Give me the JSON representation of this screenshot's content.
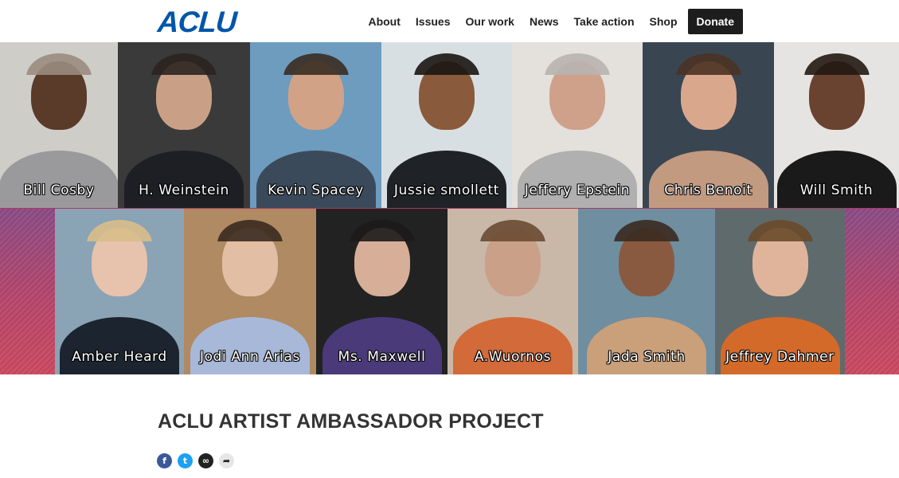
{
  "header": {
    "logo": "ACLU",
    "nav": [
      "About",
      "Issues",
      "Our work",
      "News",
      "Take action",
      "Shop"
    ],
    "donate_label": "Donate"
  },
  "collage": {
    "row1": [
      {
        "name": "Bill Cosby",
        "bg": "#cfcdc8",
        "skin": "#5a3a28",
        "cloth": "#9a9a9c",
        "hair": "#9a8c80"
      },
      {
        "name": "H. Weinstein",
        "bg": "#3a3a3a",
        "skin": "#c9a086",
        "cloth": "#1d1f24",
        "hair": "#2b2420"
      },
      {
        "name": "Kevin Spacey",
        "bg": "#6d9cbf",
        "skin": "#d1a286",
        "cloth": "#3b4a5a",
        "hair": "#3a2c22"
      },
      {
        "name": "Jussie smollett",
        "bg": "#d8dfe3",
        "skin": "#8a5a3c",
        "cloth": "#1f2226",
        "hair": "#1a1512"
      },
      {
        "name": "Jeffery Epstein",
        "bg": "#e4e0dc",
        "skin": "#cfa08a",
        "cloth": "#b0b0b0",
        "hair": "#b8b4b0"
      },
      {
        "name": "Chris Benoit",
        "bg": "#3a4552",
        "skin": "#d9a88c",
        "cloth": "#c29a80",
        "hair": "#4a3224"
      },
      {
        "name": "Will Smith",
        "bg": "#e6e4e2",
        "skin": "#6a4230",
        "cloth": "#1a1a1a",
        "hair": "#221812"
      }
    ],
    "row2": [
      {
        "name": "Amber Heard",
        "bg": "#8aa3b5",
        "skin": "#e7c2ac",
        "cloth": "#1c2430",
        "hair": "#d8be8a"
      },
      {
        "name": "Jodi Ann Arias",
        "bg": "#b08a62",
        "skin": "#e2bfa4",
        "cloth": "#a8b8d8",
        "hair": "#3a2a20"
      },
      {
        "name": "Ms. Maxwell",
        "bg": "#222222",
        "skin": "#d7ae98",
        "cloth": "#4a3a7a",
        "hair": "#1c1a1a"
      },
      {
        "name": "A.Wuornos",
        "bg": "#c9b8a8",
        "skin": "#caa088",
        "cloth": "#d26a3a",
        "hair": "#6a4a32"
      },
      {
        "name": "Jada Smith",
        "bg": "#6f8ea0",
        "skin": "#8a5a40",
        "cloth": "#c9a07a",
        "hair": "#3a2a20"
      },
      {
        "name": "Jeffrey Dahmer",
        "bg": "#5f6a6c",
        "skin": "#e0b49a",
        "cloth": "#d46a2a",
        "hair": "#6a4a2a"
      }
    ]
  },
  "page": {
    "title": "ACLU ARTIST AMBASSADOR PROJECT"
  },
  "share": [
    {
      "icon": "facebook-icon",
      "glyph": "f"
    },
    {
      "icon": "twitter-icon",
      "glyph": "t"
    },
    {
      "icon": "link-icon",
      "glyph": "∞"
    },
    {
      "icon": "share-icon",
      "glyph": "➦"
    }
  ]
}
